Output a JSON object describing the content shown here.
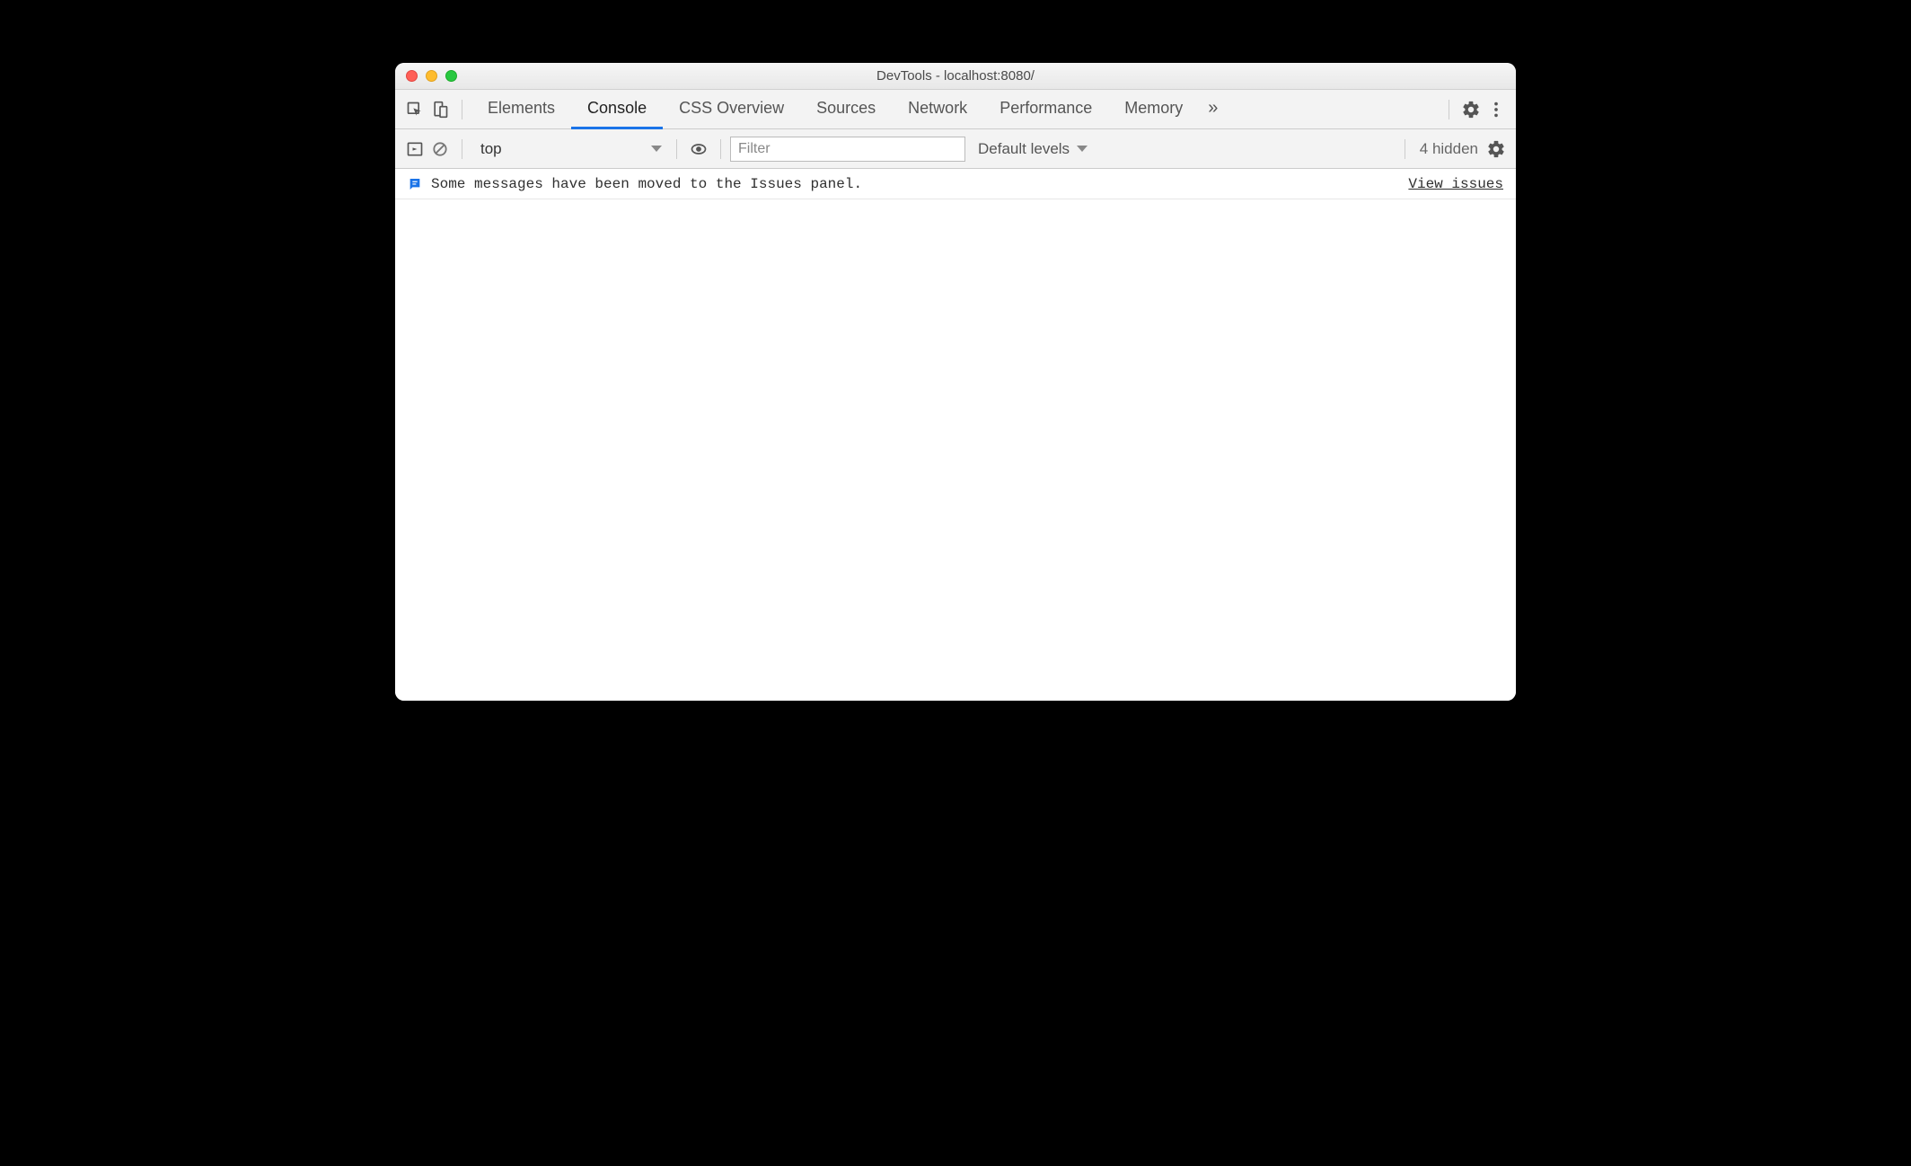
{
  "window": {
    "title": "DevTools - localhost:8080/"
  },
  "tabs": {
    "items": [
      {
        "label": "Elements",
        "active": false
      },
      {
        "label": "Console",
        "active": true
      },
      {
        "label": "CSS Overview",
        "active": false
      },
      {
        "label": "Sources",
        "active": false
      },
      {
        "label": "Network",
        "active": false
      },
      {
        "label": "Performance",
        "active": false
      },
      {
        "label": "Memory",
        "active": false
      }
    ],
    "more_glyph": "»"
  },
  "toolbar": {
    "context": "top",
    "filter_placeholder": "Filter",
    "levels_label": "Default levels",
    "hidden_label": "4 hidden"
  },
  "message": {
    "text": "Some messages have been moved to the Issues panel.",
    "link": "View issues"
  }
}
